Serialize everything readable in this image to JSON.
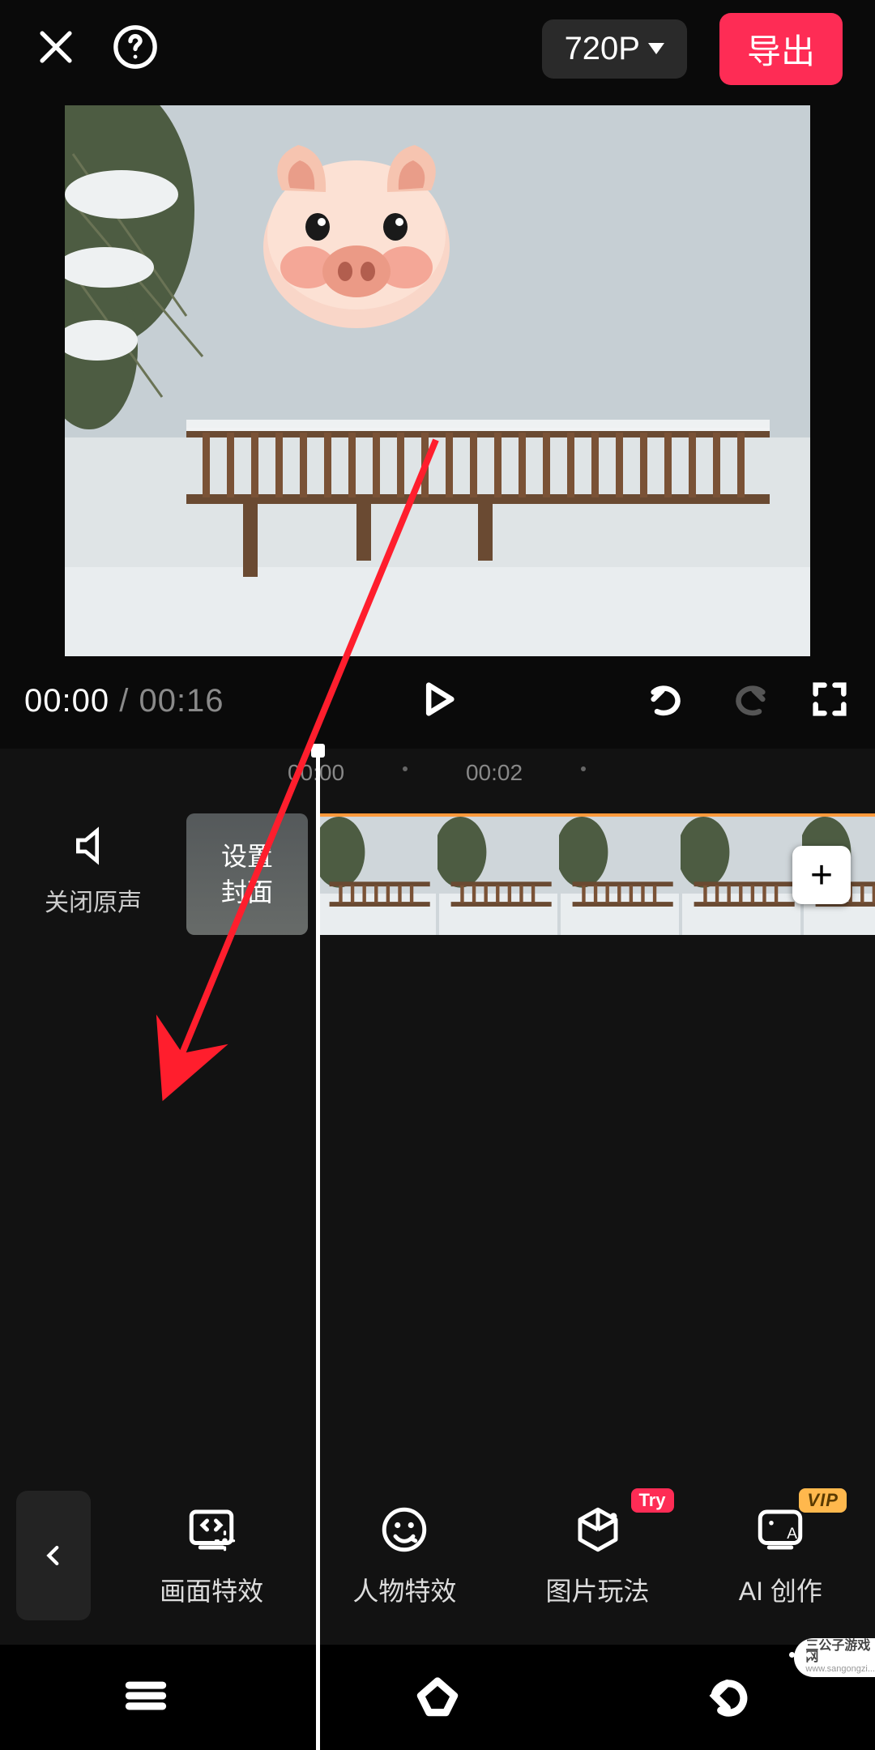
{
  "header": {
    "resolution": "720P",
    "export_label": "导出"
  },
  "transport": {
    "current_time": "00:00",
    "duration": "00:16"
  },
  "ruler": {
    "ticks": [
      "00:00",
      "00:02"
    ]
  },
  "track": {
    "mute_label": "关闭原声",
    "cover_button_line1": "设置",
    "cover_button_line2": "封面",
    "add_symbol": "+",
    "thumb_count": 5
  },
  "toolbar": {
    "back_icon": "chevron-left",
    "items": [
      {
        "label": "画面特效",
        "icon": "screen-fx",
        "badge": null
      },
      {
        "label": "人物特效",
        "icon": "face-fx",
        "badge": null
      },
      {
        "label": "图片玩法",
        "icon": "cube",
        "badge": "Try"
      },
      {
        "label": "AI 创作",
        "icon": "ai",
        "badge": "VIP"
      }
    ]
  },
  "preview": {
    "sticker": "pig-face"
  },
  "watermark": {
    "text_line1": "三公子游戏网",
    "text_line2": "www.sangongzi..."
  }
}
